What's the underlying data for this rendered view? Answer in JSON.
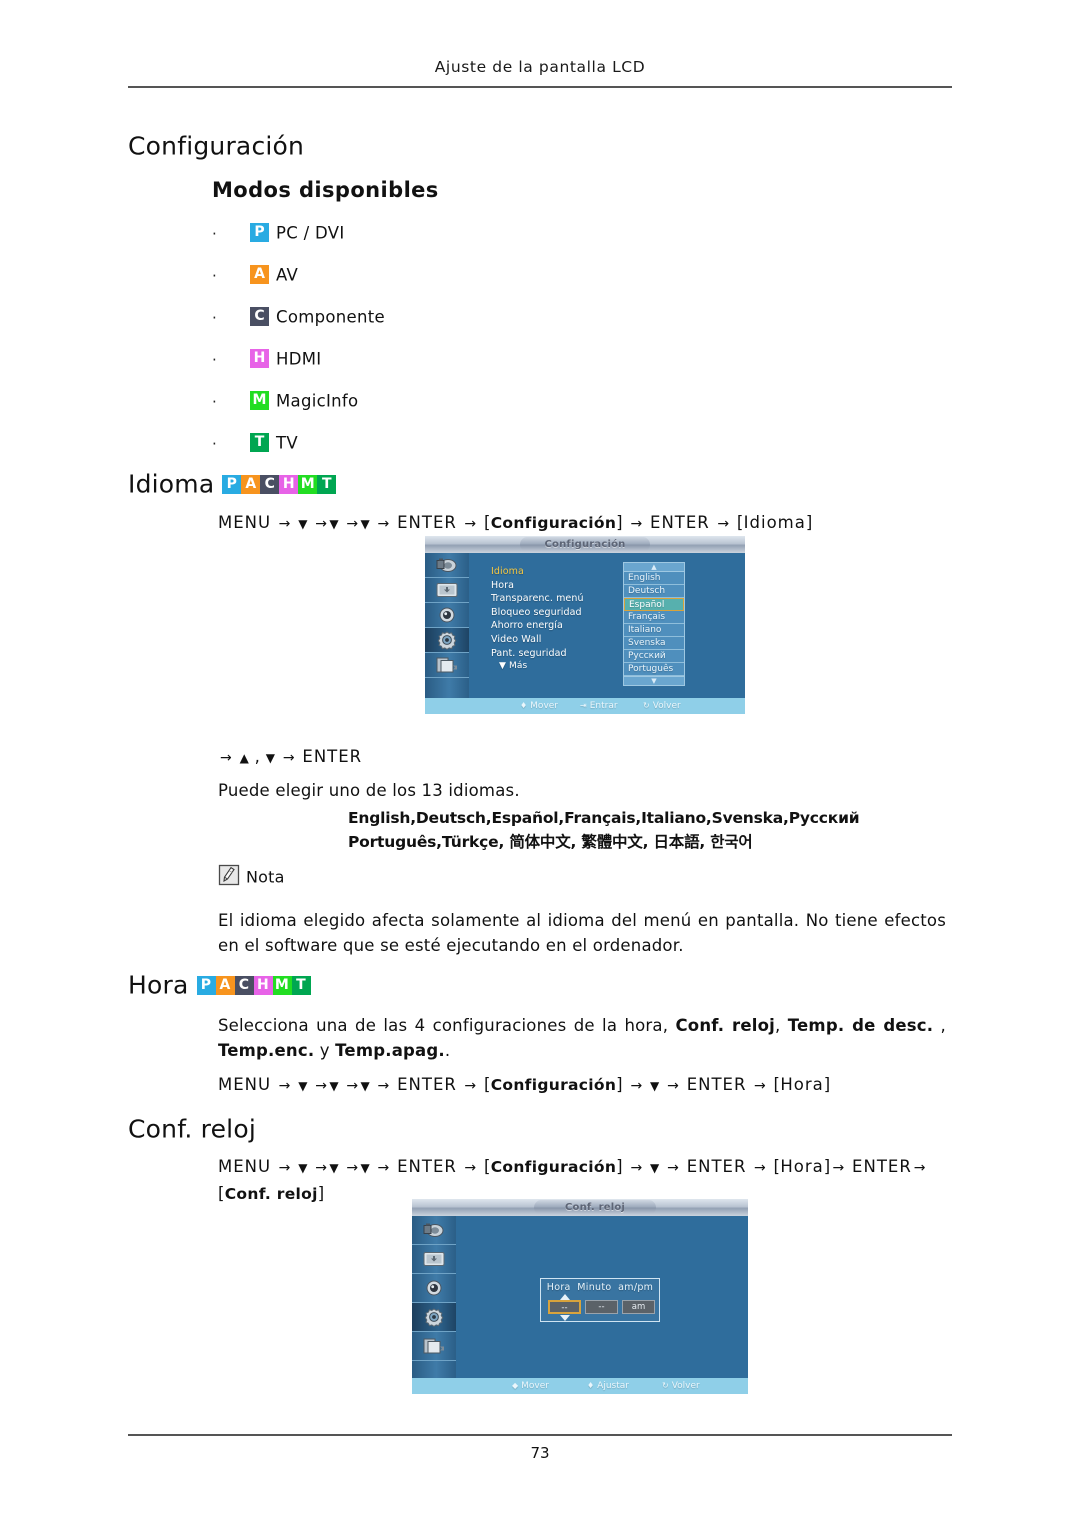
{
  "header": {
    "running_title": "Ajuste de la pantalla LCD",
    "page_number": "73"
  },
  "sections": {
    "config_title": "Configuración",
    "modes_title": "Modos disponibles",
    "modes": [
      {
        "badge": "P",
        "color": "#29abe2",
        "label": "PC / DVI"
      },
      {
        "badge": "A",
        "color": "#f7941e",
        "label": "AV"
      },
      {
        "badge": "C",
        "color": "#4a4f63",
        "label": "Componente"
      },
      {
        "badge": "H",
        "color": "#e763e7",
        "label": "HDMI"
      },
      {
        "badge": "M",
        "color": "#22dd22",
        "label": "MagicInfo"
      },
      {
        "badge": "T",
        "color": "#00a651",
        "label": "TV"
      }
    ],
    "idioma": {
      "title": "Idioma",
      "badges": [
        "P",
        "A",
        "C",
        "H",
        "M",
        "T"
      ],
      "path_prefix": "MENU",
      "path_config": "Configuración",
      "path_enter": "ENTER",
      "path_target": "Idioma",
      "sub_path": "ENTER",
      "description": "Puede elegir uno de los 13 idiomas.",
      "languages_line1": "English,Deutsch,Español,Français,Italiano,Svenska,Русский",
      "languages_line2": "Português,Türkçe, 简体中文,  繁體中文, 日本語, 한국어"
    },
    "nota": {
      "label": "Nota",
      "text": "El idioma elegido afecta solamente al idioma del menú en pantalla. No tiene efectos en el software que se esté ejecutando en el ordenador."
    },
    "hora": {
      "title": "Hora",
      "badges": [
        "P",
        "A",
        "C",
        "H",
        "M",
        "T"
      ],
      "desc_part1": "Selecciona una de las 4 configuraciones de la hora, ",
      "desc_bold1": "Conf. reloj",
      "desc_part2": ", ",
      "desc_bold2": "Temp. de desc.",
      "desc_part3": " , ",
      "desc_bold3": "Temp.enc.",
      "desc_part4": " y ",
      "desc_bold4": "Temp.apag.",
      "desc_part5": ".",
      "path_target": "Hora"
    },
    "conf_reloj": {
      "title": "Conf. reloj",
      "path_target": "Conf. reloj"
    }
  },
  "osd_idioma": {
    "title": "Configuración",
    "menu_items": [
      {
        "label": "Idioma",
        "selected": true
      },
      {
        "label": "Hora",
        "selected": false
      },
      {
        "label": "Transparenc. menú",
        "selected": false
      },
      {
        "label": "Bloqueo seguridad",
        "selected": false
      },
      {
        "label": "Ahorro energía",
        "selected": false
      },
      {
        "label": "Video Wall",
        "selected": false
      },
      {
        "label": "Pant. seguridad",
        "selected": false
      }
    ],
    "more_label": "Más",
    "languages": [
      {
        "label": "English",
        "highlighted": false
      },
      {
        "label": "Deutsch",
        "highlighted": false
      },
      {
        "label": "Español",
        "highlighted": true
      },
      {
        "label": "Français",
        "highlighted": false
      },
      {
        "label": "Italiano",
        "highlighted": false
      },
      {
        "label": "Svenska",
        "highlighted": false
      },
      {
        "label": "Русский",
        "highlighted": false
      },
      {
        "label": "Português",
        "highlighted": false
      }
    ],
    "footer": {
      "move": "Mover",
      "enter": "Entrar",
      "back": "Volver"
    }
  },
  "osd_reloj": {
    "title": "Conf. reloj",
    "fields": {
      "hour_label": "Hora",
      "minute_label": "Minuto",
      "ampm_label": "am/pm",
      "hour_value": "--",
      "minute_value": "--",
      "ampm_value": "am"
    },
    "footer": {
      "move": "Mover",
      "adjust": "Ajustar",
      "back": "Volver"
    }
  }
}
